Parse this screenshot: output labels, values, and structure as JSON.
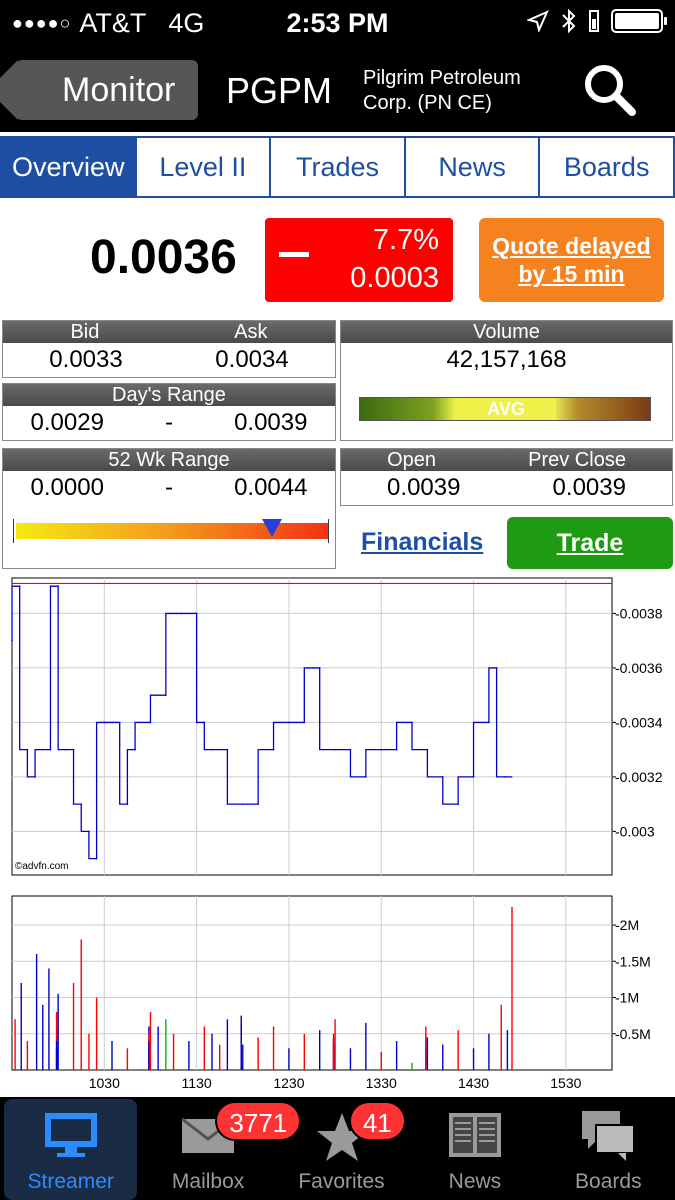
{
  "status": {
    "carrier": "AT&T",
    "network": "4G",
    "time": "2:53 PM"
  },
  "nav": {
    "back_label": "Monitor",
    "symbol": "PGPM",
    "company_line1": "Pilgrim Petroleum",
    "company_line2": "Corp. (PN CE)"
  },
  "tabs": [
    {
      "label": "Overview",
      "active": true
    },
    {
      "label": "Level II"
    },
    {
      "label": "Trades"
    },
    {
      "label": "News"
    },
    {
      "label": "Boards"
    }
  ],
  "quote": {
    "price": "0.0036",
    "change_pct": "7.7%",
    "change_abs": "0.0003",
    "delayed_line1": "Quote delayed",
    "delayed_line2": "by 15 min",
    "change_color": "#ff0000",
    "delayed_color": "#f5821f"
  },
  "bid_ask": {
    "bid_label": "Bid",
    "ask_label": "Ask",
    "bid": "0.0033",
    "ask": "0.0034"
  },
  "days_range": {
    "label": "Day's Range",
    "low": "0.0029",
    "sep": "-",
    "high": "0.0039"
  },
  "volume": {
    "label": "Volume",
    "value": "42,157,168",
    "indicator": "AVG"
  },
  "wk52": {
    "label": "52 Wk Range",
    "low": "0.0000",
    "sep": "-",
    "high": "0.0044",
    "marker_position": 0.82
  },
  "open_close": {
    "open_label": "Open",
    "close_label": "Prev Close",
    "open": "0.0039",
    "prev_close": "0.0039"
  },
  "links": {
    "financials": "Financials",
    "trade": "Trade"
  },
  "chart_data": [
    {
      "type": "line",
      "watermark": "©advfn.com",
      "x_ticks": [
        "1030",
        "1130",
        "1230",
        "1330",
        "1430",
        "1530"
      ],
      "y_ticks": [
        "0.0038",
        "0.0036",
        "0.0034",
        "0.0032",
        "0.003"
      ],
      "ylim": [
        0.00284,
        0.00393
      ],
      "reference_line": 0.00391,
      "reference_color": "#ff0000",
      "series_color": "#0000cc",
      "x": [
        930,
        935,
        940,
        945,
        950,
        955,
        1000,
        1005,
        1010,
        1015,
        1020,
        1025,
        1030,
        1035,
        1040,
        1045,
        1050,
        1100,
        1110,
        1120,
        1130,
        1135,
        1140,
        1150,
        1200,
        1210,
        1220,
        1230,
        1240,
        1250,
        1300,
        1310,
        1320,
        1330,
        1340,
        1350,
        1400,
        1410,
        1420,
        1430,
        1440,
        1445,
        1450
      ],
      "y": [
        0.0037,
        0.0039,
        0.0033,
        0.0032,
        0.0033,
        0.0033,
        0.0039,
        0.0033,
        0.0033,
        0.0031,
        0.003,
        0.0029,
        0.0034,
        0.0034,
        0.0034,
        0.0031,
        0.0033,
        0.0034,
        0.0035,
        0.0038,
        0.0038,
        0.0034,
        0.0033,
        0.0033,
        0.0031,
        0.0031,
        0.0033,
        0.0034,
        0.0034,
        0.0036,
        0.0033,
        0.0033,
        0.0032,
        0.0033,
        0.0033,
        0.0034,
        0.0033,
        0.0032,
        0.0031,
        0.0032,
        0.0034,
        0.0036,
        0.0032
      ]
    },
    {
      "type": "bar",
      "x_ticks": [
        "1030",
        "1130",
        "1230",
        "1330",
        "1430",
        "1530"
      ],
      "y_ticks": [
        "2M",
        "1.5M",
        "1M",
        "0.5M"
      ],
      "ylim": [
        0,
        2400000
      ],
      "bars": [
        {
          "x": 932,
          "v": 700000,
          "c": "#ff0000"
        },
        {
          "x": 936,
          "v": 1200000,
          "c": "#0000cc"
        },
        {
          "x": 940,
          "v": 400000,
          "c": "#ff0000"
        },
        {
          "x": 946,
          "v": 1600000,
          "c": "#0000cc"
        },
        {
          "x": 950,
          "v": 900000,
          "c": "#0000cc"
        },
        {
          "x": 954,
          "v": 1400000,
          "c": "#0000cc"
        },
        {
          "x": 960,
          "v": 300000,
          "c": "#0000cc"
        },
        {
          "x": 965,
          "v": 600000,
          "c": "#ff0000"
        },
        {
          "x": 972,
          "v": 300000,
          "c": "#0000cc"
        },
        {
          "x": 980,
          "v": 800000,
          "c": "#ff0000"
        },
        {
          "x": 990,
          "v": 400000,
          "c": "#0000cc"
        },
        {
          "x": 1000,
          "v": 1050000,
          "c": "#0000cc"
        },
        {
          "x": 1010,
          "v": 1200000,
          "c": "#ff0000"
        },
        {
          "x": 1015,
          "v": 1800000,
          "c": "#ff0000"
        },
        {
          "x": 1020,
          "v": 500000,
          "c": "#ff0000"
        },
        {
          "x": 1025,
          "v": 1000000,
          "c": "#ff0000"
        },
        {
          "x": 1035,
          "v": 400000,
          "c": "#0000cc"
        },
        {
          "x": 1045,
          "v": 300000,
          "c": "#ff0000"
        },
        {
          "x": 1060,
          "v": 600000,
          "c": "#0000cc"
        },
        {
          "x": 1075,
          "v": 500000,
          "c": "#ff0000"
        },
        {
          "x": 1090,
          "v": 400000,
          "c": "#0000cc"
        },
        {
          "x": 1100,
          "v": 800000,
          "c": "#ff0000"
        },
        {
          "x": 1105,
          "v": 600000,
          "c": "#0000cc"
        },
        {
          "x": 1110,
          "v": 700000,
          "c": "#00bb00"
        },
        {
          "x": 1115,
          "v": 500000,
          "c": "#ff0000"
        },
        {
          "x": 1125,
          "v": 400000,
          "c": "#0000cc"
        },
        {
          "x": 1135,
          "v": 600000,
          "c": "#ff0000"
        },
        {
          "x": 1140,
          "v": 500000,
          "c": "#0000cc"
        },
        {
          "x": 1145,
          "v": 350000,
          "c": "#ff0000"
        },
        {
          "x": 1150,
          "v": 700000,
          "c": "#0000cc"
        },
        {
          "x": 1160,
          "v": 600000,
          "c": "#ff0000"
        },
        {
          "x": 1170,
          "v": 750000,
          "c": "#0000cc"
        },
        {
          "x": 1180,
          "v": 500000,
          "c": "#ff0000"
        },
        {
          "x": 1190,
          "v": 650000,
          "c": "#0000cc"
        },
        {
          "x": 1200,
          "v": 350000,
          "c": "#0000cc"
        },
        {
          "x": 1210,
          "v": 450000,
          "c": "#ff0000"
        },
        {
          "x": 1220,
          "v": 600000,
          "c": "#ff0000"
        },
        {
          "x": 1230,
          "v": 300000,
          "c": "#0000cc"
        },
        {
          "x": 1240,
          "v": 500000,
          "c": "#ff0000"
        },
        {
          "x": 1250,
          "v": 550000,
          "c": "#0000cc"
        },
        {
          "x": 1260,
          "v": 400000,
          "c": "#0000cc"
        },
        {
          "x": 1270,
          "v": 450000,
          "c": "#ff0000"
        },
        {
          "x": 1280,
          "v": 350000,
          "c": "#0000cc"
        },
        {
          "x": 1290,
          "v": 500000,
          "c": "#ff0000"
        },
        {
          "x": 1300,
          "v": 700000,
          "c": "#ff0000"
        },
        {
          "x": 1310,
          "v": 300000,
          "c": "#0000cc"
        },
        {
          "x": 1320,
          "v": 650000,
          "c": "#0000cc"
        },
        {
          "x": 1330,
          "v": 250000,
          "c": "#ff0000"
        },
        {
          "x": 1340,
          "v": 400000,
          "c": "#0000cc"
        },
        {
          "x": 1350,
          "v": 100000,
          "c": "#00bb00"
        },
        {
          "x": 1360,
          "v": 350000,
          "c": "#0000cc"
        },
        {
          "x": 1370,
          "v": 500000,
          "c": "#ff0000"
        },
        {
          "x": 1380,
          "v": 300000,
          "c": "#0000cc"
        },
        {
          "x": 1390,
          "v": 600000,
          "c": "#ff0000"
        },
        {
          "x": 1400,
          "v": 450000,
          "c": "#0000cc"
        },
        {
          "x": 1410,
          "v": 350000,
          "c": "#0000cc"
        },
        {
          "x": 1420,
          "v": 550000,
          "c": "#ff0000"
        },
        {
          "x": 1430,
          "v": 300000,
          "c": "#0000cc"
        },
        {
          "x": 1440,
          "v": 500000,
          "c": "#0000cc"
        },
        {
          "x": 1448,
          "v": 900000,
          "c": "#ff0000"
        },
        {
          "x": 1452,
          "v": 550000,
          "c": "#0000cc"
        },
        {
          "x": 1455,
          "v": 2250000,
          "c": "#ff0000"
        }
      ]
    }
  ],
  "tabbar": [
    {
      "label": "Streamer",
      "icon": "monitor-icon",
      "active": true
    },
    {
      "label": "Mailbox",
      "icon": "envelope-icon",
      "badge": "3771"
    },
    {
      "label": "Favorites",
      "icon": "star-icon",
      "badge": "41"
    },
    {
      "label": "News",
      "icon": "newspaper-icon"
    },
    {
      "label": "Boards",
      "icon": "chat-bubbles-icon"
    }
  ]
}
